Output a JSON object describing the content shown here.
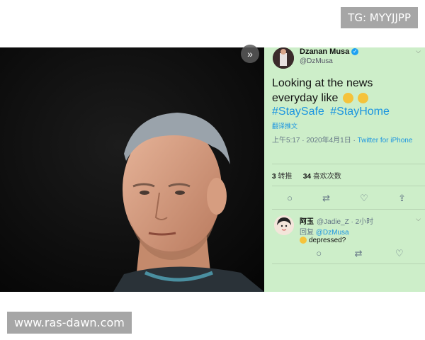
{
  "watermarks": {
    "top": "TG: MYYJJPP",
    "bottom": "www.ras-dawn.com"
  },
  "photo": {
    "expand_icon": "chevrons-right-icon"
  },
  "tweet": {
    "name": "Dzanan Musa",
    "handle": "@DzMusa",
    "text": "Looking at the news everyday like",
    "hashtags": [
      "#StaySafe",
      "#StayHome"
    ],
    "translate": "翻译推文",
    "time": "上午5:17 · 2020年4月1日 · ",
    "source": "Twitter for iPhone",
    "retweets_count": "3",
    "retweets_label": "转推",
    "likes_count": "34",
    "likes_label": "喜欢次数"
  },
  "reply": {
    "name": "阿玉",
    "handle": "@Jadie_Z · 2小时",
    "reply_prefix": "回复 ",
    "reply_to": "@DzMusa",
    "text": "depressed?"
  },
  "colors": {
    "panel_bg": "#cdeec9",
    "link": "#1b95e0"
  }
}
